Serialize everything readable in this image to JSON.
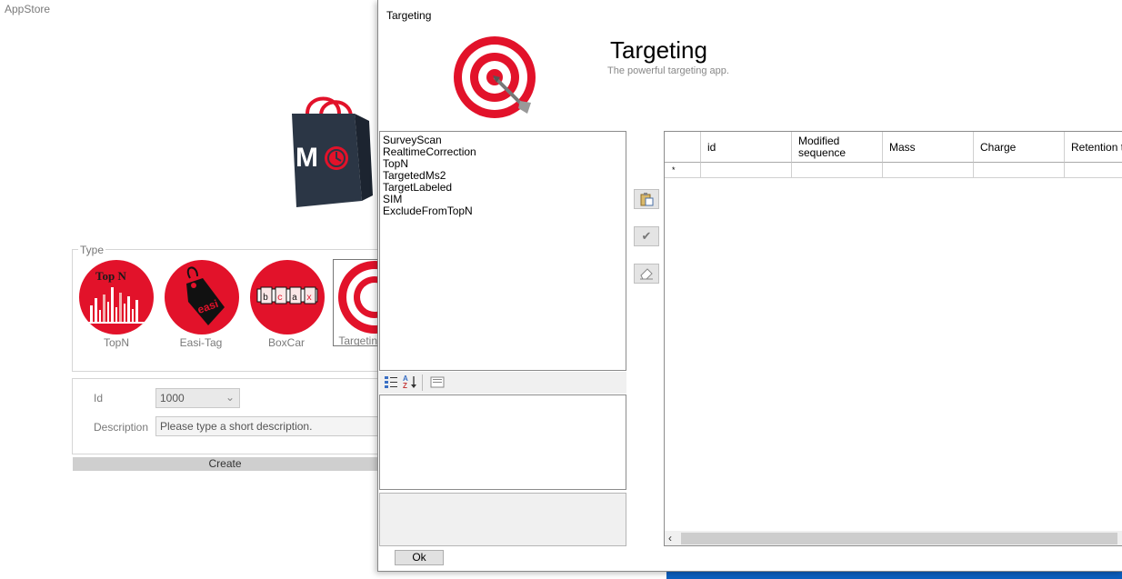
{
  "app": {
    "title": "AppStore",
    "logo_letter": "M",
    "type_group_label": "Type",
    "apps": [
      {
        "label": "TopN",
        "logo_text": "Top N"
      },
      {
        "label": "Easi-Tag",
        "logo_text": "easi"
      },
      {
        "label": "BoxCar",
        "logo_text": "bcaxr"
      },
      {
        "label": "Targeting"
      }
    ],
    "id_label": "Id",
    "id_value": "1000",
    "description_label": "Description",
    "description_placeholder": "Please type a short description.",
    "create_label": "Create"
  },
  "dialog": {
    "window_title": "Targeting",
    "title": "Targeting",
    "subtitle": "The powerful targeting app.",
    "method_list": [
      "SurveyScan",
      "RealtimeCorrection",
      "TopN",
      "TargetedMs2",
      "TargetLabeled",
      "SIM",
      "ExcludeFromTopN"
    ],
    "grid": {
      "columns": [
        "id",
        "Modified sequence",
        "Mass",
        "Charge",
        "Retention time"
      ],
      "new_row_marker": "*"
    },
    "ok_label": "Ok"
  },
  "colors": {
    "brand_red": "#e2122a",
    "desktop_blue": "#0b5fbf"
  }
}
